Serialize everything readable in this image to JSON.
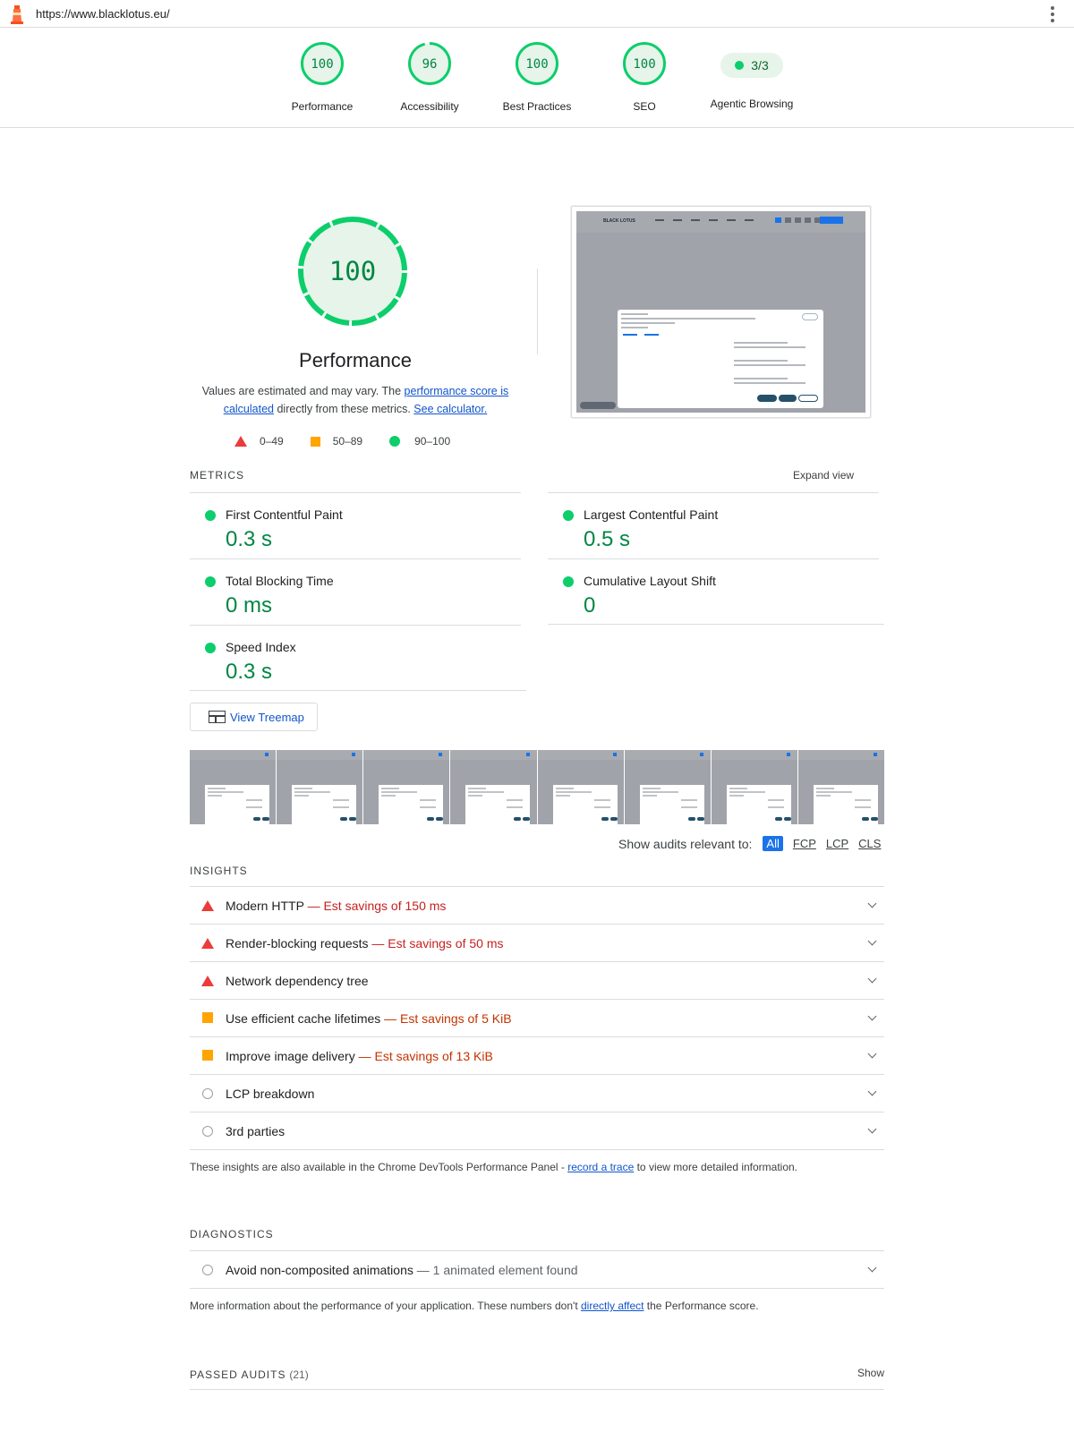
{
  "url": "https://www.blacklotus.eu/",
  "colors": {
    "pass": "#0cce6b",
    "pass_text": "#018642",
    "average": "#ffa400",
    "fail": "#eb3b3b",
    "link": "#1155cc",
    "accent": "#1a73e8"
  },
  "categories": [
    {
      "label": "Performance",
      "score": "100",
      "score_fraction": 1.0
    },
    {
      "label": "Accessibility",
      "score": "96",
      "score_fraction": 0.96
    },
    {
      "label": "Best Practices",
      "score": "100",
      "score_fraction": 1.0
    },
    {
      "label": "SEO",
      "score": "100",
      "score_fraction": 1.0
    }
  ],
  "agentic": {
    "label": "Agentic Browsing",
    "value": "3/3"
  },
  "performance": {
    "score": "100",
    "title": "Performance",
    "desc_pre": "Values are estimated and may vary. The ",
    "desc_link1": "performance score is calculated",
    "desc_mid": " directly from these metrics. ",
    "desc_link2": "See calculator."
  },
  "legend": {
    "fail": "0–49",
    "average": "50–89",
    "pass": "90–100"
  },
  "metrics": {
    "title": "METRICS",
    "expand": "Expand view",
    "items": [
      {
        "name": "First Contentful Paint",
        "value": "0.3 s"
      },
      {
        "name": "Largest Contentful Paint",
        "value": "0.5 s"
      },
      {
        "name": "Total Blocking Time",
        "value": "0 ms"
      },
      {
        "name": "Cumulative Layout Shift",
        "value": "0"
      },
      {
        "name": "Speed Index",
        "value": "0.3 s"
      }
    ]
  },
  "treemap_label": "View Treemap",
  "filter": {
    "label": "Show audits relevant to:",
    "options": [
      "All",
      "FCP",
      "LCP",
      "CLS"
    ]
  },
  "insights": {
    "title": "INSIGHTS",
    "items": [
      {
        "status": "fail",
        "title": "Modern HTTP",
        "savings": "— Est savings of 150 ms"
      },
      {
        "status": "fail",
        "title": "Render-blocking requests",
        "savings": "— Est savings of 50 ms"
      },
      {
        "status": "fail",
        "title": "Network dependency tree",
        "savings": ""
      },
      {
        "status": "average",
        "title": "Use efficient cache lifetimes",
        "savings": "— Est savings of 5 KiB"
      },
      {
        "status": "average",
        "title": "Improve image delivery",
        "savings": "— Est savings of 13 KiB"
      },
      {
        "status": "informative",
        "title": "LCP breakdown",
        "savings": ""
      },
      {
        "status": "informative",
        "title": "3rd parties",
        "savings": ""
      }
    ],
    "note_pre": "These insights are also available in the Chrome DevTools Performance Panel - ",
    "note_link": "record a trace",
    "note_post": " to view more detailed information."
  },
  "diagnostics": {
    "title": "DIAGNOSTICS",
    "items": [
      {
        "status": "informative",
        "title": "Avoid non-composited animations",
        "detail": "— 1 animated element found"
      }
    ],
    "note_pre": "More information about the performance of your application. These numbers don't ",
    "note_link": "directly affect",
    "note_post": " the Performance score."
  },
  "passed": {
    "title": "PASSED AUDITS",
    "count": "(21)",
    "show": "Show"
  },
  "screenshot": {
    "brand": "BLACK LOTUS"
  }
}
